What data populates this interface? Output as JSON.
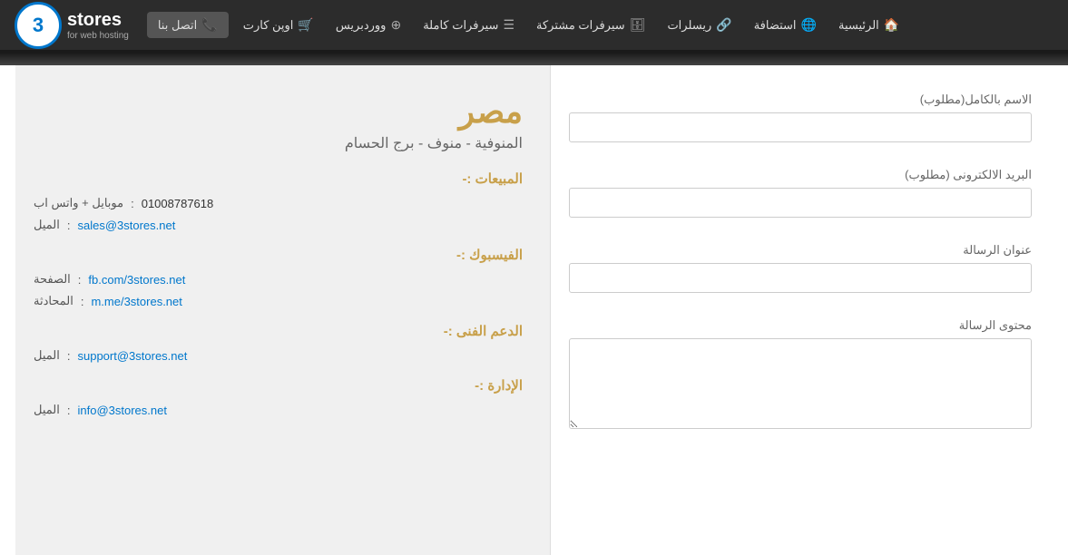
{
  "logo": {
    "number": "3",
    "brand": "stores",
    "tagline": "for web hosting"
  },
  "nav": {
    "items": [
      {
        "label": "الرئيسية",
        "icon": "🏠",
        "id": "home"
      },
      {
        "label": "استضافة",
        "icon": "🌐",
        "id": "hosting"
      },
      {
        "label": "ريسلرات",
        "icon": "🔗",
        "id": "resellers"
      },
      {
        "label": "سيرفرات مشتركة",
        "icon": "🗄",
        "id": "shared-servers"
      },
      {
        "label": "سيرفرات كاملة",
        "icon": "☰",
        "id": "dedicated-servers"
      },
      {
        "label": "ووردبريس",
        "icon": "⊕",
        "id": "wordpress"
      },
      {
        "label": "اوپن كارت",
        "icon": "🛒",
        "id": "opencart"
      },
      {
        "label": "اتصل بنا",
        "icon": "📞",
        "id": "contact"
      }
    ]
  },
  "form": {
    "full_name_label": "الاسم بالكامل(مطلوب)",
    "full_name_placeholder": "",
    "email_label": "البريد الالكترونى (مطلوب)",
    "email_placeholder": "",
    "subject_label": "عنوان الرسالة",
    "subject_placeholder": "",
    "message_label": "محتوى الرسالة",
    "message_placeholder": ""
  },
  "contact_info": {
    "country": "مصر",
    "location": "المنوفية - منوف - برج الحسام",
    "sales_title": "المبيعات :-",
    "mobile_label": "موبايل + واتس اب",
    "mobile_colon": ":",
    "mobile_value": "01008787618",
    "email_label": "الميل",
    "email_colon": ":",
    "sales_email": "sales@3stores.net",
    "facebook_title": "الفيسبوك :-",
    "page_label": "الصفحة",
    "page_colon": ":",
    "page_link": "fb.com/3stores.net",
    "chat_label": "المحادثة",
    "chat_colon": ":",
    "chat_link": "m.me/3stores.net",
    "support_title": "الدعم الفنى :-",
    "support_email_label": "الميل",
    "support_email_colon": ":",
    "support_email": "support@3stores.net",
    "admin_title": "الإدارة :-",
    "admin_email_label": "الميل",
    "admin_email_colon": ":",
    "admin_email": "info@3stores.net"
  }
}
